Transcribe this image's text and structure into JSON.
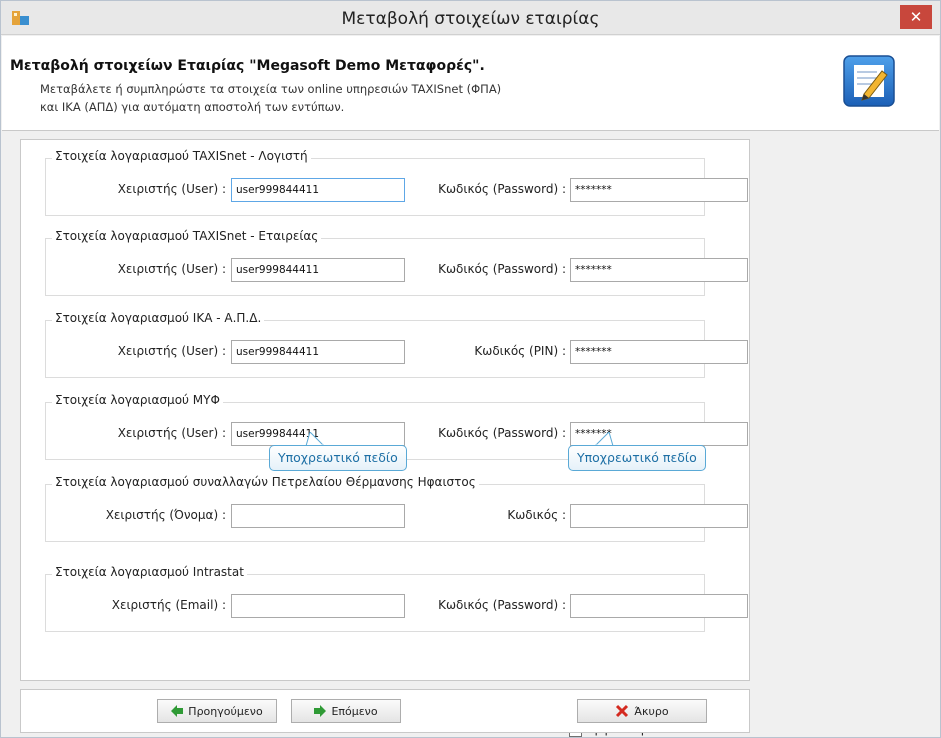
{
  "window": {
    "title": "Μεταβολή στοιχείων εταιρίας",
    "close_glyph": "✕"
  },
  "header": {
    "title": "Μεταβολή στοιχείων Εταιρίας \"Megasoft Demo Μεταφορές\".",
    "description_line1": "Μεταβάλετε ή συμπληρώστε τα στοιχεία των online υπηρεσιών TAXISnet (ΦΠΑ)",
    "description_line2": "και ΙΚΑ (ΑΠΔ) για αυτόματη αποστολή των εντύπων.",
    "icon": "edit-note-icon"
  },
  "groups": [
    {
      "title": "Στοιχεία λογαριασμού TAXISnet - Λογιστή",
      "user_label": "Χειριστής (User) :",
      "user_value": "user999844411",
      "pass_label": "Κωδικός (Password) :",
      "pass_value": "*******"
    },
    {
      "title": "Στοιχεία λογαριασμού TAXISnet - Εταιρείας",
      "user_label": "Χειριστής (User) :",
      "user_value": "user999844411",
      "pass_label": "Κωδικός (Password) :",
      "pass_value": "*******"
    },
    {
      "title": "Στοιχεία λογαριασμού ΙΚΑ - Α.Π.Δ.",
      "user_label": "Χειριστής (User) :",
      "user_value": "user999844411",
      "pass_label": "Κωδικός (PIN) :",
      "pass_value": "*******"
    },
    {
      "title": "Στοιχεία λογαριασμού ΜΥΦ",
      "user_label": "Χειριστής (User) :",
      "user_value": "user999844411",
      "pass_label": "Κωδικός (Password) :",
      "pass_value": "*******"
    },
    {
      "title": "Στοιχεία λογαριασμού συναλλαγών Πετρελαίου Θέρμανσης Ηφαιστος",
      "user_label": "Χειριστής (Όνομα) :",
      "user_value": "",
      "pass_label": "Κωδικός :",
      "pass_value": ""
    },
    {
      "title": "Στοιχεία λογαριασμού Intrastat",
      "user_label": "Χειριστής (Email) :",
      "user_value": "",
      "pass_label": "Κωδικός (Password) :",
      "pass_value": ""
    }
  ],
  "tooltips": {
    "user": "Υποχρεωτικό πεδίο",
    "pass": "Υποχρεωτικό πεδίο"
  },
  "show_passwords": {
    "label": "Εμφάνιση κωδικών",
    "checked": false
  },
  "buttons": {
    "previous": "Προηγούμενο",
    "next": "Επόμενο",
    "cancel": "Άκυρο"
  },
  "colors": {
    "accent": "#5aa9d6",
    "tooltip_text": "#1d6fa5",
    "close": "#c8473c",
    "arrow_green": "#2f9a35",
    "cancel_red": "#d42a20"
  }
}
